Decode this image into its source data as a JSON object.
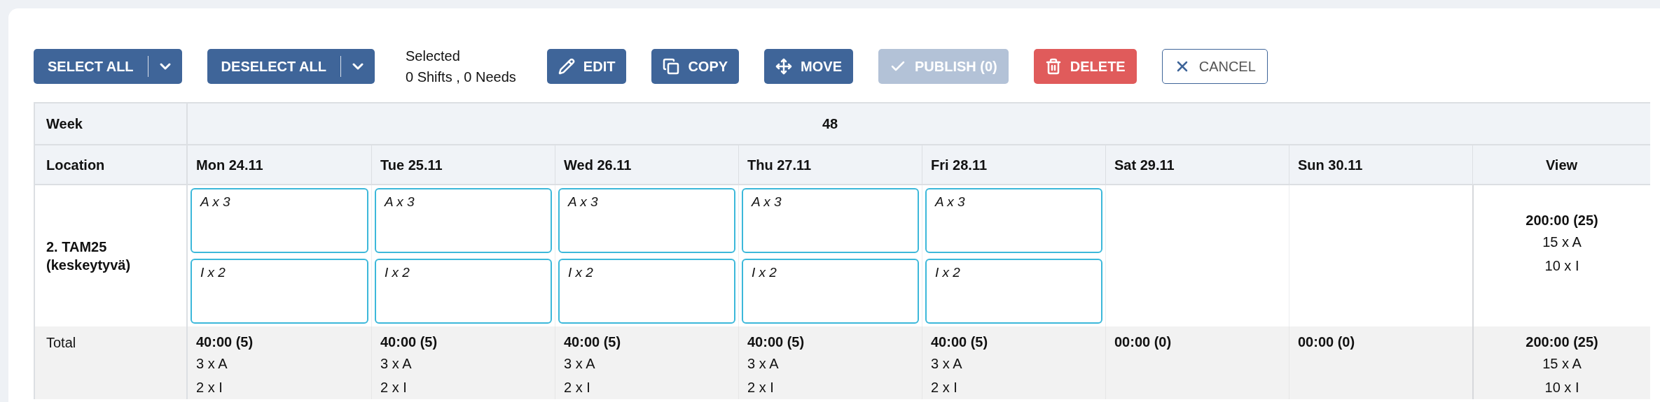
{
  "toolbar": {
    "buttons": [
      {
        "kind": "split",
        "label": "SELECT ALL"
      },
      {
        "kind": "split",
        "label": "DESELECT ALL"
      },
      {
        "kind": "info",
        "title": "Selected",
        "text": "0 Shifts , 0 Needs"
      },
      {
        "kind": "edit",
        "label": "EDIT"
      },
      {
        "kind": "copy",
        "label": "COPY"
      },
      {
        "kind": "move",
        "label": "MOVE"
      },
      {
        "kind": "publish",
        "label": "PUBLISH (0)",
        "disabled": true
      },
      {
        "kind": "delete",
        "label": "DELETE"
      },
      {
        "kind": "cancel",
        "label": "CANCEL"
      }
    ]
  },
  "table": {
    "week_label": "Week",
    "week": "48",
    "location_label": "Location",
    "days": [
      "Mon 24.11",
      "Tue 25.11",
      "Wed 26.11",
      "Thu 27.11",
      "Fri 28.11",
      "Sat 29.11",
      "Sun 30.11"
    ],
    "view_label": "View",
    "rows": [
      {
        "location": "2. TAM25 (keskeytyvä)",
        "cells": [
          [
            "A x 3",
            "I x 2"
          ],
          [
            "A x 3",
            "I x 2"
          ],
          [
            "A x 3",
            "I x 2"
          ],
          [
            "A x 3",
            "I x 2"
          ],
          [
            "A x 3",
            "I x 2"
          ],
          [],
          []
        ],
        "summary": {
          "hours": "200:00 (25)",
          "lines": [
            "15 x A",
            "10 x I"
          ]
        }
      }
    ],
    "total": {
      "label": "Total",
      "cells": [
        {
          "hours": "40:00 (5)",
          "lines": [
            "3 x A",
            "2 x I"
          ]
        },
        {
          "hours": "40:00 (5)",
          "lines": [
            "3 x A",
            "2 x I"
          ]
        },
        {
          "hours": "40:00 (5)",
          "lines": [
            "3 x A",
            "2 x I"
          ]
        },
        {
          "hours": "40:00 (5)",
          "lines": [
            "3 x A",
            "2 x I"
          ]
        },
        {
          "hours": "40:00 (5)",
          "lines": [
            "3 x A",
            "2 x I"
          ]
        },
        {
          "hours": "00:00 (0)"
        },
        {
          "hours": "00:00 (0)"
        }
      ],
      "summary": {
        "hours": "200:00 (25)",
        "lines": [
          "15 x A",
          "10 x I"
        ]
      }
    }
  }
}
